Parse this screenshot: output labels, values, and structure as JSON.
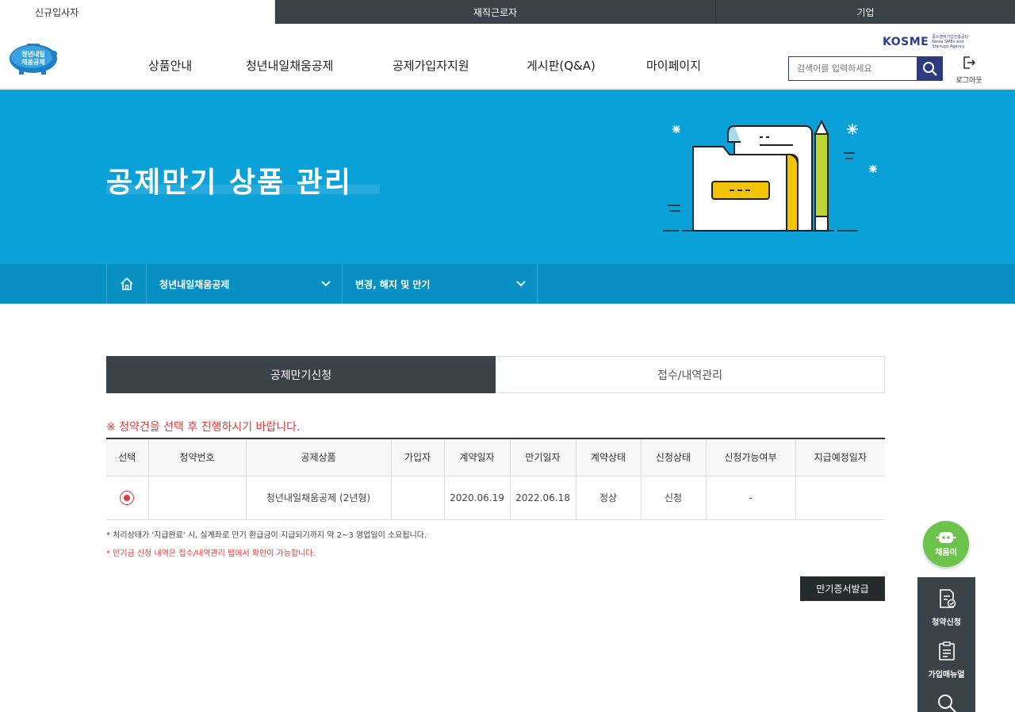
{
  "audience_tabs": [
    "신규입사자",
    "재직근로자",
    "기업"
  ],
  "logo": {
    "line1": "청년내일",
    "line2": "채움공제"
  },
  "nav": [
    "상품안내",
    "청년내일채움공제",
    "공제가입자지원",
    "게시판(Q&A)",
    "마이페이지"
  ],
  "kosme": {
    "name": "KOSME",
    "sub": "중소벤처기업진흥공단 Korea SMEs and Startups Agency"
  },
  "search": {
    "placeholder": "검색어를 입력하세요"
  },
  "logout": {
    "label": "로그아웃"
  },
  "banner": {
    "title": "공제만기 상품 관리"
  },
  "breadcrumb": {
    "level1": "청년내일채움공제",
    "level2": "변경, 해지 및 만기"
  },
  "tabs": [
    "공제만기신청",
    "접수/내역관리"
  ],
  "notice": "※ 청약건을 선택 후 진행하시기 바랍니다.",
  "table": {
    "headers": [
      "선택",
      "청약번호",
      "공제상품",
      "가입자",
      "계약일자",
      "만기일자",
      "계약상태",
      "신청상태",
      "신청가능여부",
      "지급예정일자"
    ],
    "rows": [
      {
        "product": "청년내일채움공제 (2년형)",
        "subscriber": "",
        "number": "",
        "contract_date": "2020.06.19",
        "maturity_date": "2022.06.18",
        "contract_status": "정상",
        "apply_status": "신청",
        "available": "-",
        "pay_date": ""
      }
    ]
  },
  "notes": [
    "* 처리상태가 '지급완료' 시, 실계좌로 만기 환급금이 지급되기까지 약 2~3 영업일이 소요됩니다.",
    "* 만기금 신청 내역은 접수/내역관리 탭에서 확인이 가능합니다."
  ],
  "cert_button": "만기증서발급",
  "chatbot": {
    "label": "채움이"
  },
  "quick_menu": [
    "청약신청",
    "가입매뉴얼"
  ],
  "colors": {
    "banner": "#0aa0d8",
    "crumb_bar": "#0890c3",
    "dark": "#3a4347",
    "alert": "#e03a3a",
    "accent_navy": "#2d3a7c"
  }
}
